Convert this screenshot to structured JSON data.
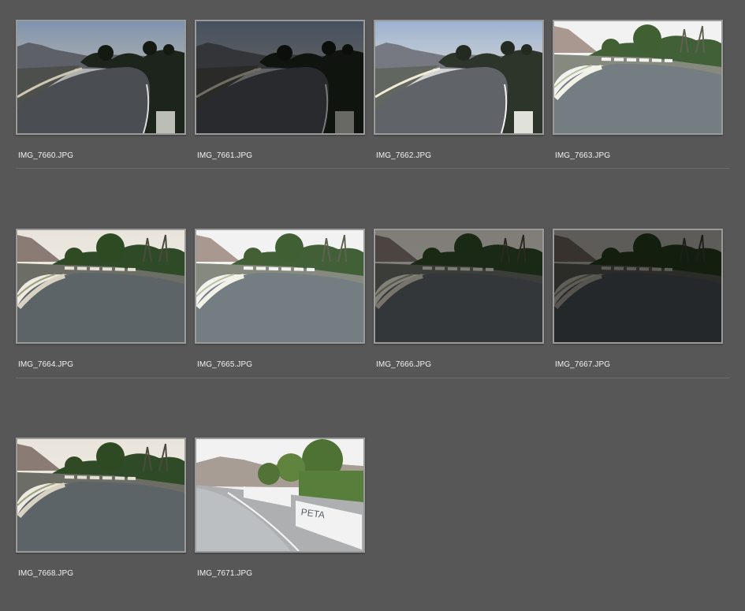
{
  "grid": {
    "items": [
      {
        "filename": "IMG_7660.JPG",
        "scene": "road-curve-dusk",
        "exposure": "normal"
      },
      {
        "filename": "IMG_7661.JPG",
        "scene": "road-curve-dusk",
        "exposure": "dark"
      },
      {
        "filename": "IMG_7662.JPG",
        "scene": "road-curve-dusk",
        "exposure": "bright"
      },
      {
        "filename": "IMG_7663.JPG",
        "scene": "road-curve-day",
        "exposure": "bright"
      },
      {
        "filename": "IMG_7664.JPG",
        "scene": "road-curve-day",
        "exposure": "normal"
      },
      {
        "filename": "IMG_7665.JPG",
        "scene": "road-curve-day",
        "exposure": "bright"
      },
      {
        "filename": "IMG_7666.JPG",
        "scene": "road-curve-day",
        "exposure": "dark"
      },
      {
        "filename": "IMG_7667.JPG",
        "scene": "road-curve-day",
        "exposure": "darker"
      },
      {
        "filename": "IMG_7668.JPG",
        "scene": "road-curve-day",
        "exposure": "normal"
      },
      {
        "filename": "IMG_7671.JPG",
        "scene": "road-barrier-graffiti",
        "exposure": "bright"
      }
    ]
  },
  "colors": {
    "background": "#575757",
    "thumbnail_border": "#9a9a9a",
    "label_text": "#f2f2f2",
    "divider": "#6b6b6b"
  }
}
